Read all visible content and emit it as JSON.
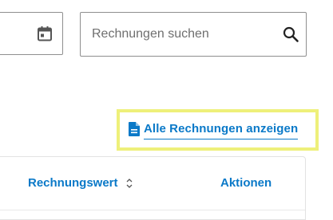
{
  "search": {
    "placeholder": "Rechnungen suchen",
    "value": ""
  },
  "date_filter": {
    "icon": "calendar-icon"
  },
  "all_invoices_link": {
    "label": "Alle Rechnungen anzeigen",
    "icon": "document-icon"
  },
  "table": {
    "columns": [
      {
        "label": "Rechnungswert",
        "sortable": true,
        "sort_icon": "sort-icon"
      },
      {
        "label": "Aktionen",
        "sortable": false
      }
    ]
  },
  "colors": {
    "accent": "#0a79c8",
    "highlight": "#eef07a",
    "border": "#8f8f8f"
  }
}
